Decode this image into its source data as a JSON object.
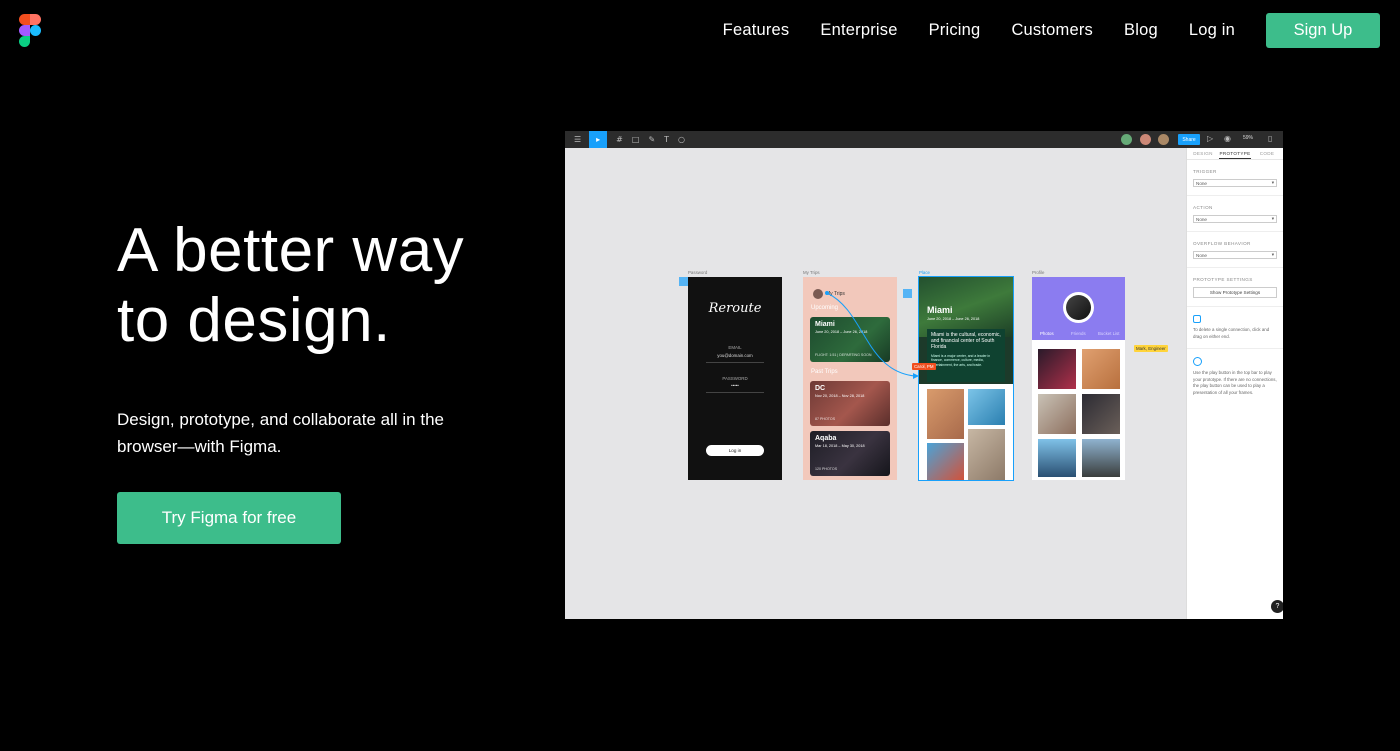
{
  "nav": {
    "items": [
      "Features",
      "Enterprise",
      "Pricing",
      "Customers",
      "Blog",
      "Log in"
    ],
    "signup": "Sign Up"
  },
  "hero": {
    "title_line1": "A better way",
    "title_line2": "to design.",
    "subtitle": "Design, prototype, and collaborate all in the browser—with Figma.",
    "cta": "Try Figma for free"
  },
  "app": {
    "toolbar": {
      "share": "Share",
      "zoom": "59%"
    },
    "right_panel": {
      "tabs": [
        "DESIGN",
        "PROTOTYPE",
        "CODE"
      ],
      "active_tab": "PROTOTYPE",
      "trigger_label": "TRIGGER",
      "trigger_value": "None",
      "action_label": "ACTION",
      "action_value": "None",
      "overflow_label": "OVERFLOW BEHAVIOR",
      "overflow_value": "None",
      "settings_label": "PROTOTYPE SETTINGS",
      "settings_button": "Show Prototype Settings",
      "note1": "To delete a single connection, click and drag on either end.",
      "note2": "Use the play button in the top bar to play your prototype. If there are no connections, the play button can be used to play a presentation of all your frames."
    },
    "frames": {
      "password": {
        "label": "Password",
        "logo": "Reroute",
        "email_label": "EMAIL",
        "email": "you@domain.com",
        "password_label": "PASSWORD",
        "password": "•••••",
        "login": "Log in"
      },
      "trips": {
        "label": "My Trips",
        "header": "My Trips",
        "upcoming": "Upcoming",
        "miami": "Miami",
        "miami_dates": "June 20, 2018 – June 26, 2018",
        "miami_foot": "FLIGHT: 1:51 | DEPARTING SOON",
        "past": "Past Trips",
        "dc": "DC",
        "dc_dates": "Nov 20, 2018 – Nov 28, 2018",
        "dc_foot": "87 PHOTOS",
        "aqaba": "Aqaba",
        "aqaba_dates": "Mar 18, 2018 – May 30, 2018",
        "aqaba_foot": "120 PHOTOS"
      },
      "place": {
        "label": "Place",
        "title": "Miami",
        "dates": "June 20, 2018 – June 26, 2018",
        "headline": "Miami is the cultural, economic, and financial center of South Florida",
        "body": "Miami is a major center, and a leader in finance, commerce, culture, media, entertainment, the arts, and trade."
      },
      "profile": {
        "label": "Profile",
        "tabs": [
          "Photos",
          "Friends",
          "Bucket List"
        ]
      }
    },
    "cursors": {
      "cursor1": "Carol, PM",
      "cursor2": "Mark, Engineer"
    }
  }
}
